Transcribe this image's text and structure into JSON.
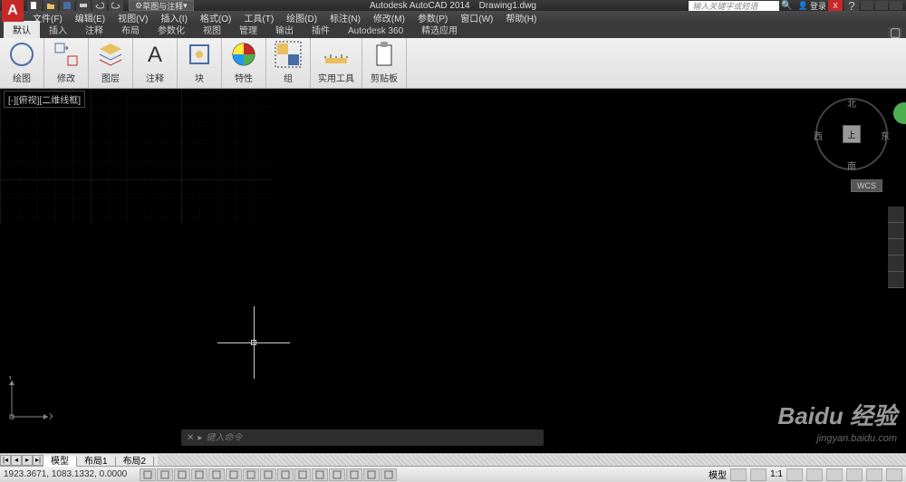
{
  "title": {
    "app": "Autodesk AutoCAD 2014",
    "doc": "Drawing1.dwg"
  },
  "workspace": "草图与注释",
  "search_placeholder": "输入关键字或短语",
  "signin_label": "登录",
  "menubar": [
    "文件(F)",
    "编辑(E)",
    "视图(V)",
    "插入(I)",
    "格式(O)",
    "工具(T)",
    "绘图(D)",
    "标注(N)",
    "修改(M)",
    "参数(P)",
    "窗口(W)",
    "帮助(H)"
  ],
  "ribbon_tabs": [
    "默认",
    "插入",
    "注释",
    "布局",
    "参数化",
    "视图",
    "管理",
    "输出",
    "插件",
    "Autodesk 360",
    "精选应用"
  ],
  "ribbon_active_tab": 0,
  "ribbon_panels": [
    {
      "label": "绘图",
      "icon": "circle"
    },
    {
      "label": "修改",
      "icon": "modify"
    },
    {
      "label": "图层",
      "icon": "layers"
    },
    {
      "label": "注释",
      "icon": "text"
    },
    {
      "label": "块",
      "icon": "block"
    },
    {
      "label": "特性",
      "icon": "color"
    },
    {
      "label": "组",
      "icon": "group"
    },
    {
      "label": "实用工具",
      "icon": "util"
    },
    {
      "label": "剪贴板",
      "icon": "clip"
    }
  ],
  "viewport_label": "[-][俯视][二维线框]",
  "viewcube": {
    "top": "上",
    "n": "北",
    "s": "南",
    "e": "东",
    "w": "西"
  },
  "wcs_label": "WCS",
  "ucs": {
    "x": "X",
    "y": "Y"
  },
  "cmdline": {
    "prompt": "▸",
    "placeholder": "键入命令"
  },
  "model_tabs": [
    "模型",
    "布局1",
    "布局2"
  ],
  "model_active": 0,
  "statusbar": {
    "coords": "1923.3671, 1083.1332, 0.0000",
    "right_label_model": "模型",
    "right_scale": "1:1"
  },
  "watermark": {
    "main": "Baidu 经验",
    "sub": "jingyan.baidu.com"
  }
}
